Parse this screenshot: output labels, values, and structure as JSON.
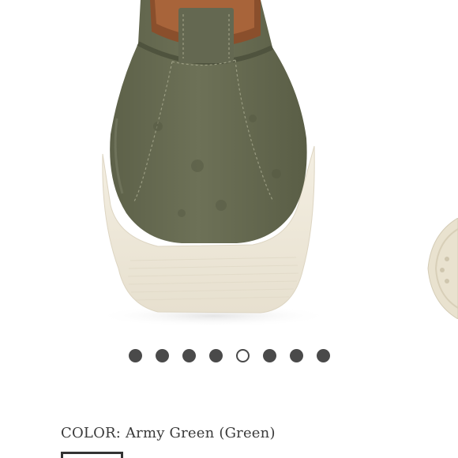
{
  "gallery": {
    "image_subject": "army green suede slip-on sneaker, rear view",
    "slide_count": 8,
    "active_slide": 5,
    "colors": {
      "suede": "#6b6e55",
      "sole": "#f2ede0",
      "dot": "#4a4a4a"
    }
  },
  "product": {
    "color_label": "COLOR:",
    "color_value": "Army Green (Green)"
  }
}
